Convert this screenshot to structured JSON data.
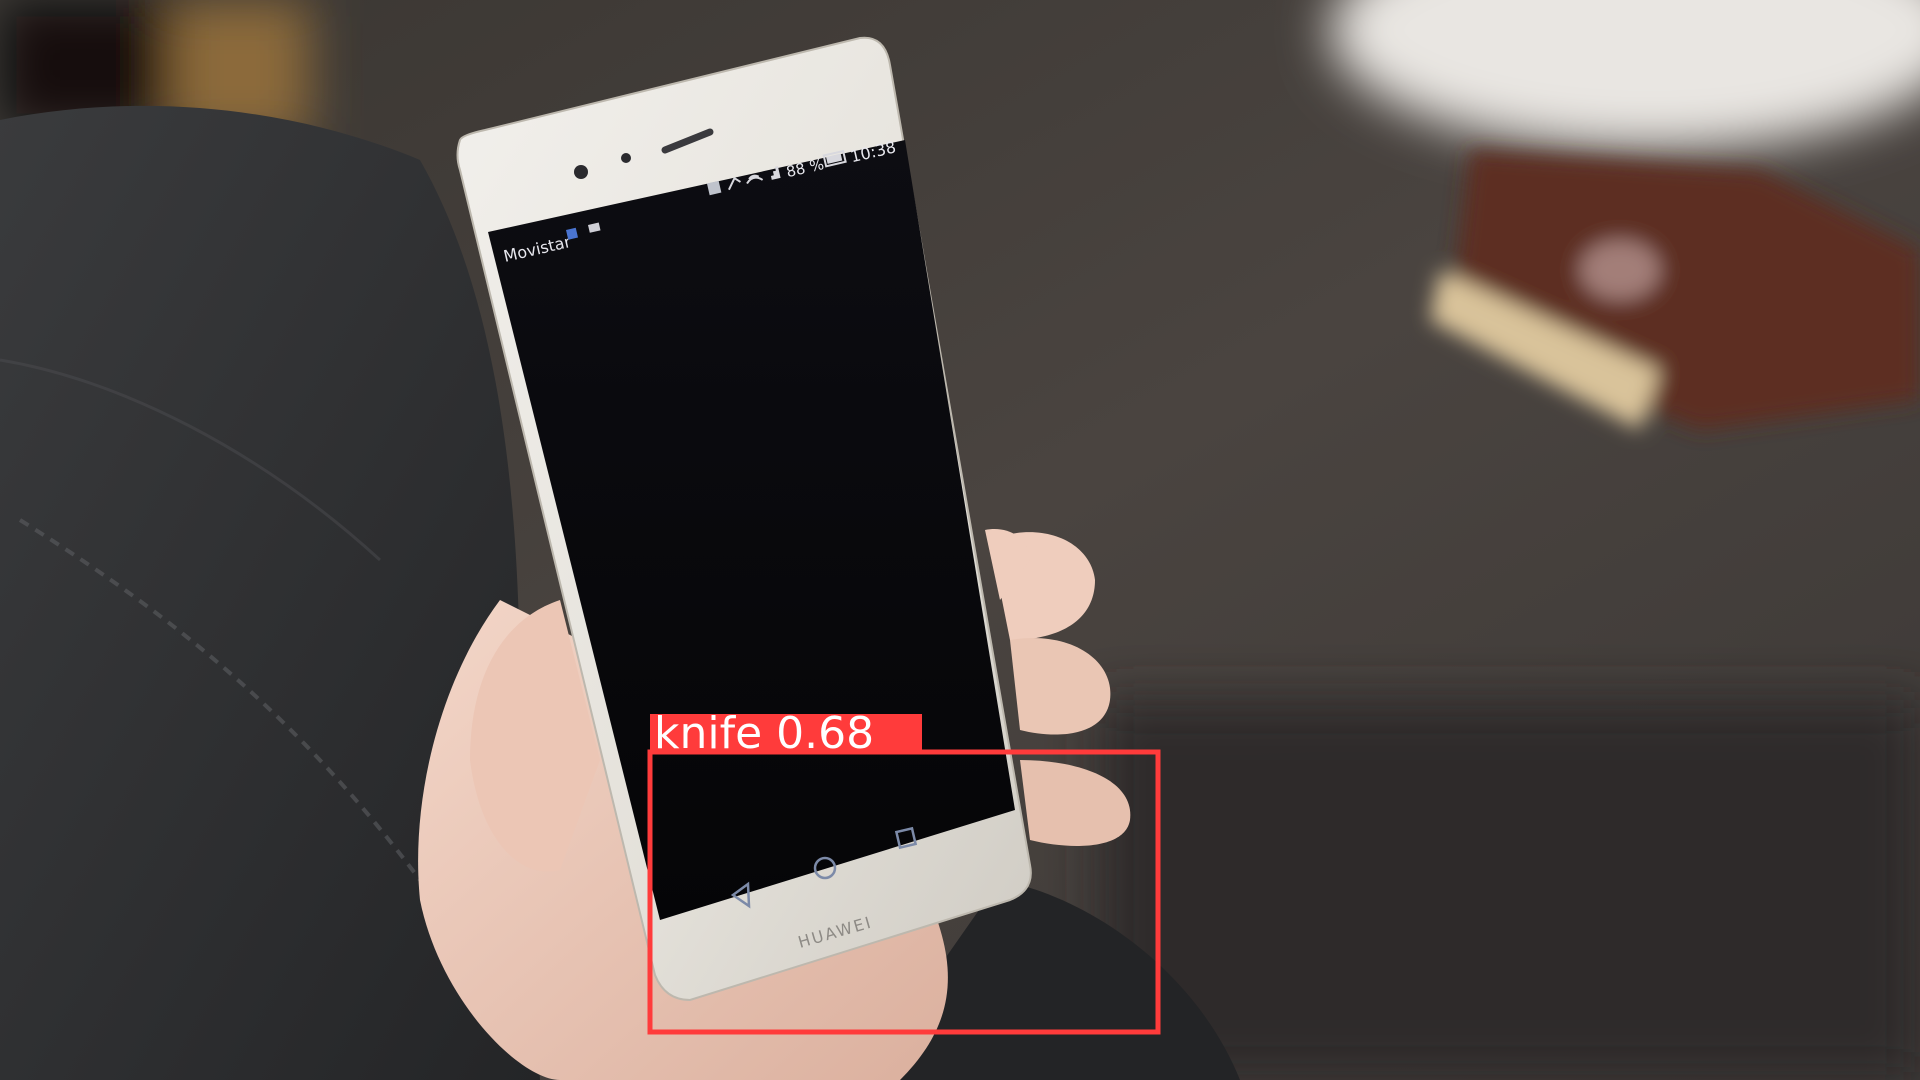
{
  "phone": {
    "carrier": "Movistar",
    "battery": "88 %",
    "time": "10:38",
    "brand": "HUAWEI"
  },
  "detection": {
    "label": "knife 0.68",
    "class": "knife",
    "confidence": 0.68,
    "color": "#ff3b3b"
  },
  "icons": {
    "nav_back": "triangle-back-icon",
    "nav_home": "circle-home-icon",
    "nav_recents": "square-recents-icon"
  }
}
